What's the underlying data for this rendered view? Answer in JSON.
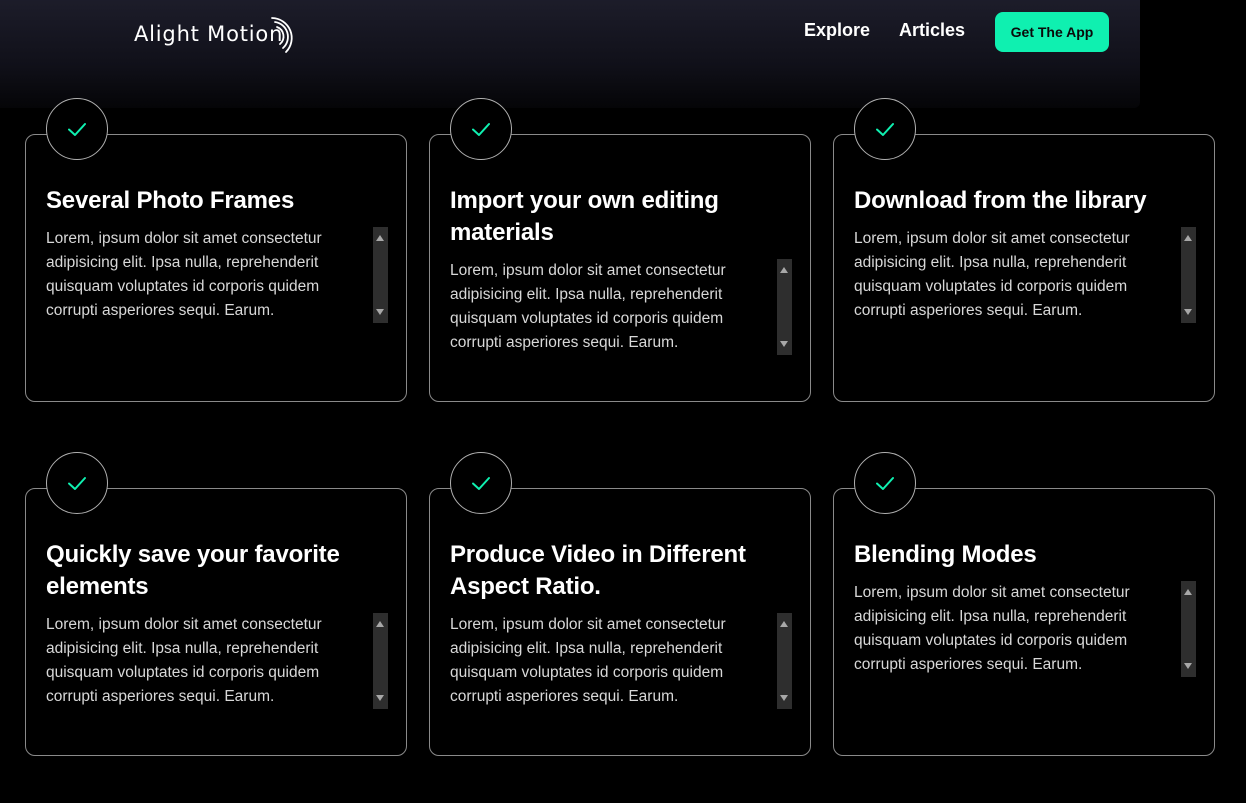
{
  "header": {
    "logo_text": "Alight Motion",
    "nav": {
      "explore": "Explore",
      "articles": "Articles"
    },
    "cta_label": "Get The App"
  },
  "colors": {
    "background": "#000000",
    "accent": "#0ff0b0",
    "card_border": "#8a8a8a"
  },
  "features": [
    {
      "icon": "check-icon",
      "title": "Several Photo Frames",
      "text": "Lorem, ipsum dolor sit amet consectetur adipisicing elit. Ipsa nulla, reprehenderit quisquam voluptates id corporis quidem corrupti asperiores sequi. Earum."
    },
    {
      "icon": "check-icon",
      "title": "Import your own editing materials",
      "text": "Lorem, ipsum dolor sit amet consectetur adipisicing elit. Ipsa nulla, reprehenderit quisquam voluptates id corporis quidem corrupti asperiores sequi. Earum."
    },
    {
      "icon": "check-icon",
      "title": "Download from the library",
      "text": "Lorem, ipsum dolor sit amet consectetur adipisicing elit. Ipsa nulla, reprehenderit quisquam voluptates id corporis quidem corrupti asperiores sequi. Earum."
    },
    {
      "icon": "check-icon",
      "title": "Quickly save your favorite elements",
      "text": "Lorem, ipsum dolor sit amet consectetur adipisicing elit. Ipsa nulla, reprehenderit quisquam voluptates id corporis quidem corrupti asperiores sequi. Earum."
    },
    {
      "icon": "check-icon",
      "title": "Produce Video in Different Aspect Ratio.",
      "text": "Lorem, ipsum dolor sit amet consectetur adipisicing elit. Ipsa nulla, reprehenderit quisquam voluptates id corporis quidem corrupti asperiores sequi. Earum."
    },
    {
      "icon": "check-icon",
      "title": "Blending Modes",
      "text": "Lorem, ipsum dolor sit amet consectetur adipisicing elit. Ipsa nulla, reprehenderit quisquam voluptates id corporis quidem corrupti asperiores sequi. Earum."
    }
  ]
}
